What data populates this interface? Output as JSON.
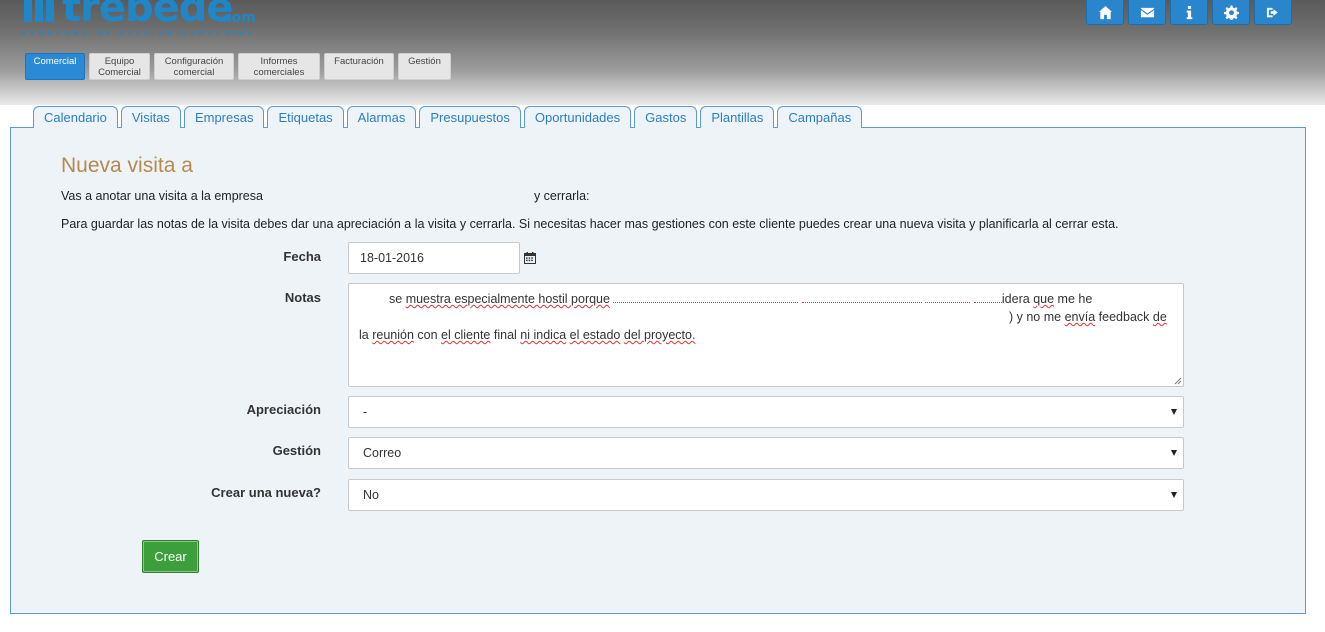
{
  "brand": {
    "name": "trebede",
    "suffix": ".com",
    "tagline": "PROGRAMA DE GESTIÓN COMERCIAL",
    "accent": "#1f86c8"
  },
  "top_icons": [
    "home-icon",
    "envelope-icon",
    "info-icon",
    "gear-icon",
    "logout-icon"
  ],
  "module_tabs": [
    {
      "label": "Comercial",
      "active": true
    },
    {
      "label": "Equipo Comercial",
      "active": false
    },
    {
      "label": "Configuración comercial",
      "active": false
    },
    {
      "label": "Informes comerciales",
      "active": false
    },
    {
      "label": "Facturación",
      "active": false
    },
    {
      "label": "Gestión",
      "active": false
    }
  ],
  "sub_tabs": [
    {
      "label": "Calendario"
    },
    {
      "label": "Visitas"
    },
    {
      "label": "Empresas"
    },
    {
      "label": "Etiquetas"
    },
    {
      "label": "Alarmas"
    },
    {
      "label": "Presupuestos"
    },
    {
      "label": "Oportunidades"
    },
    {
      "label": "Gastos"
    },
    {
      "label": "Plantillas"
    },
    {
      "label": "Campañas"
    }
  ],
  "form": {
    "title": "Nueva visita a",
    "intro_prefix": "Vas a anotar una visita a la empresa",
    "intro_suffix": "y cerrarla:",
    "info": "Para guardar las notas de la visita debes dar una apreciación a la visita y cerrarla. Si necesitas hacer mas gestiones con este cliente puedes crear una nueva visita y planificarla al cerrar esta.",
    "fecha": {
      "label": "Fecha",
      "value": "18-01-2016"
    },
    "notas": {
      "label": "Notas",
      "line1_a": "se",
      "line1_b": "muestra especialmente hostil porque",
      "line1_c": "idera",
      "line1_d": "que",
      "line1_e": "me he",
      "line2_a": ") y no me",
      "line2_b": "envía",
      "line2_c": "feedback",
      "line2_d": "de",
      "line3_a": "la",
      "line3_b": "reunión",
      "line3_c": "con",
      "line3_d": "el cliente",
      "line3_e": "final",
      "line3_f": "ni indica",
      "line3_g": "el estado",
      "line3_h": "del proyecto."
    },
    "apreciacion": {
      "label": "Apreciación",
      "value": "-"
    },
    "gestion": {
      "label": "Gestión",
      "value": "Correo"
    },
    "crear_nueva": {
      "label": "Crear una nueva?",
      "value": "No"
    },
    "submit_label": "Crear"
  },
  "colors": {
    "primary_button": "#2a86cc",
    "submit_button": "#3d9f3b",
    "title": "#b48a4f",
    "tab_text": "#2a7fc1"
  }
}
